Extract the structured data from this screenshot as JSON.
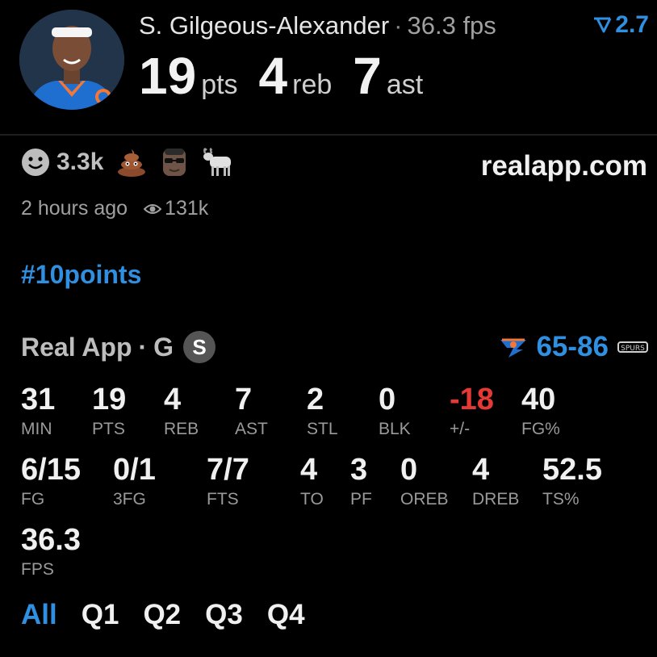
{
  "player": {
    "name": "S. Gilgeous-Alexander",
    "separator": "·",
    "fps_text": "36.3 fps",
    "trend_value": "2.7",
    "header_stats": [
      {
        "value": "19",
        "label": "pts"
      },
      {
        "value": "4",
        "label": "reb"
      },
      {
        "value": "7",
        "label": "ast"
      }
    ]
  },
  "reactions": {
    "count": "3.3k",
    "icons": [
      "smile-icon",
      "poop-emoji-icon",
      "sunglasses-face-icon",
      "goat-emoji-icon"
    ]
  },
  "site": "realapp.com",
  "meta": {
    "time": "2 hours ago",
    "views": "131k"
  },
  "hashtag": "#10points",
  "box": {
    "source": "Real App",
    "separator": "·",
    "position": "G",
    "badge": "S",
    "score": "65-86",
    "colors": {
      "accent": "#2f8fe0",
      "negative": "#e53935"
    },
    "rows": [
      [
        {
          "value": "31",
          "label": "MIN"
        },
        {
          "value": "19",
          "label": "PTS"
        },
        {
          "value": "4",
          "label": "REB"
        },
        {
          "value": "7",
          "label": "AST"
        },
        {
          "value": "2",
          "label": "STL"
        },
        {
          "value": "0",
          "label": "BLK"
        },
        {
          "value": "-18",
          "label": "+/-"
        },
        {
          "value": "40",
          "label": "FG%"
        }
      ],
      [
        {
          "value": "6/15",
          "label": "FG"
        },
        {
          "value": "0/1",
          "label": "3FG"
        },
        {
          "value": "7/7",
          "label": "FTS"
        },
        {
          "value": "4",
          "label": "TO"
        },
        {
          "value": "3",
          "label": "PF"
        },
        {
          "value": "0",
          "label": "OREB"
        },
        {
          "value": "4",
          "label": "DREB"
        },
        {
          "value": "52.5",
          "label": "TS%"
        }
      ],
      [
        {
          "value": "36.3",
          "label": "FPS"
        }
      ]
    ]
  },
  "tabs": [
    {
      "label": "All",
      "active": true
    },
    {
      "label": "Q1",
      "active": false
    },
    {
      "label": "Q2",
      "active": false
    },
    {
      "label": "Q3",
      "active": false
    },
    {
      "label": "Q4",
      "active": false
    }
  ]
}
